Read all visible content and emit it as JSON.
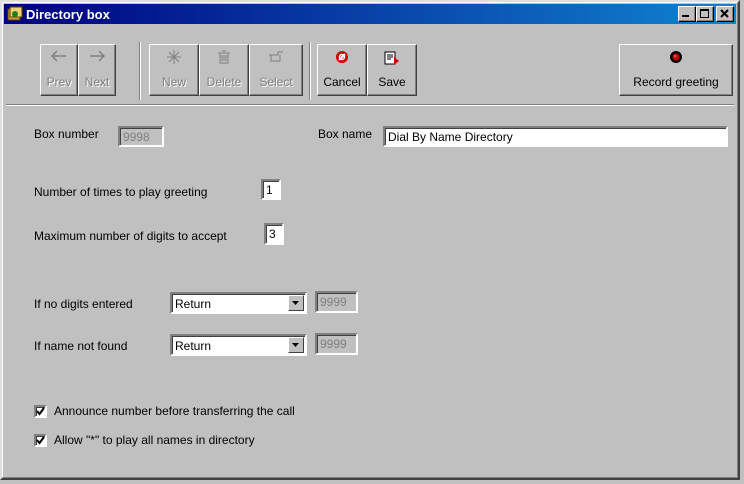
{
  "window": {
    "title": "Directory box"
  },
  "toolbar": {
    "prev": "Prev",
    "next": "Next",
    "new": "New",
    "delete": "Delete",
    "select": "Select",
    "cancel": "Cancel",
    "save": "Save",
    "record_greeting": "Record greeting"
  },
  "form": {
    "box_number_label": "Box number",
    "box_number_value": "9998",
    "box_name_label": "Box name",
    "box_name_value": "Dial By Name Directory",
    "play_greeting_label": "Number of times to play greeting",
    "play_greeting_value": "1",
    "max_digits_label": "Maximum number of digits to accept",
    "max_digits_value": "3",
    "no_digits_label": "If no digits entered",
    "no_digits_action": "Return",
    "no_digits_box": "9999",
    "not_found_label": "If name not found",
    "not_found_action": "Return",
    "not_found_box": "9999",
    "announce_label": "Announce number before transferring the call",
    "announce_checked": true,
    "allow_star_label": "Allow \"*\" to play all names in directory",
    "allow_star_checked": true
  },
  "colors": {
    "titlebar_start": "#000080",
    "titlebar_end": "#1084d0",
    "face": "#c0c0c0",
    "record_dot": "#cc0000"
  }
}
